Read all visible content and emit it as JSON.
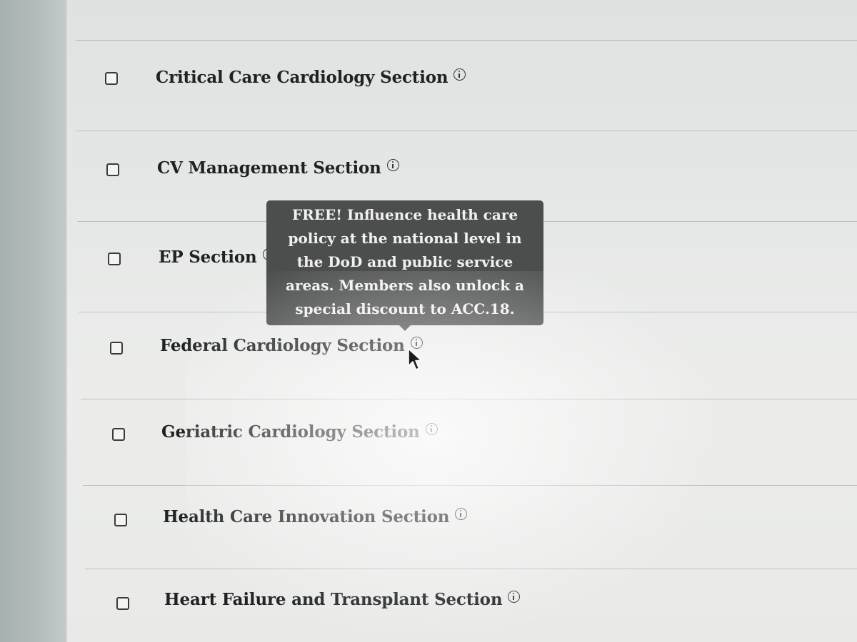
{
  "sections": [
    {
      "label": "Critical Care Cardiology Section",
      "checked": false
    },
    {
      "label": "CV Management Section",
      "checked": false
    },
    {
      "label": "EP Section",
      "checked": false
    },
    {
      "label": "Federal Cardiology Section",
      "checked": false
    },
    {
      "label": "Geriatric Cardiology Section",
      "checked": false
    },
    {
      "label": "Health Care Innovation Section",
      "checked": false
    },
    {
      "label": "Heart Failure and Transplant Section",
      "checked": false
    }
  ],
  "tooltip": {
    "lines": [
      "FREE! Influence health care",
      "policy at the national level in",
      "the DoD and public service",
      "areas. Members also unlock a",
      "special discount to ACC.18."
    ],
    "background": "#4c4e4d",
    "text_color": "#f1f1f1"
  },
  "icons": {
    "info": "info-icon",
    "checkbox": "checkbox-icon",
    "pointer": "mouse-pointer-icon"
  }
}
